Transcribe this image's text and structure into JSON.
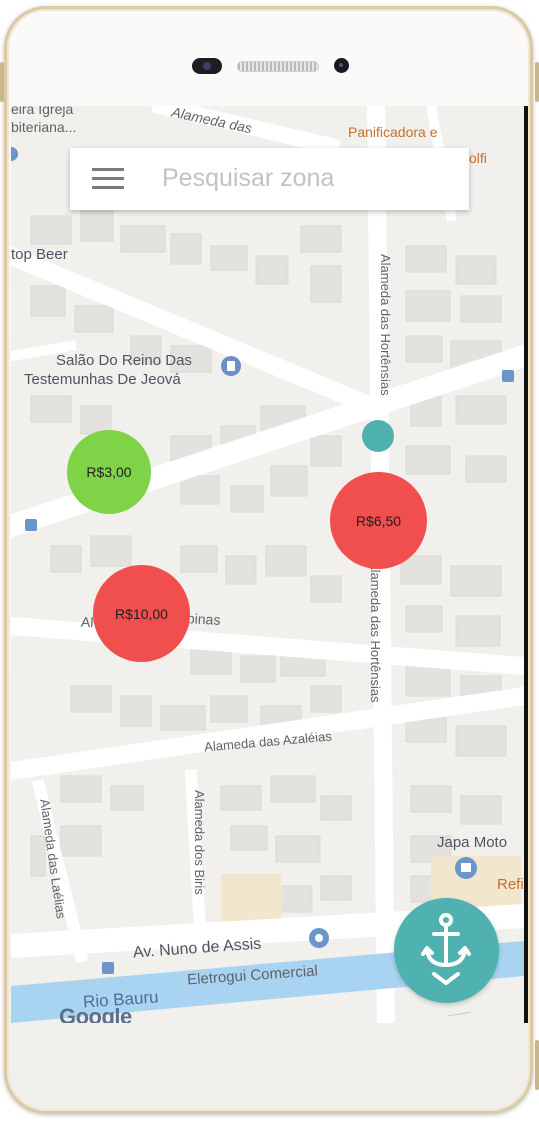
{
  "search": {
    "placeholder": "Pesquisar zona"
  },
  "map": {
    "labels": {
      "igreja_line1": "eira Igreja",
      "igreja_line2": "biteriana...",
      "alameda_top": "Alameda das",
      "panificadora": "Panificadora e",
      "olfi": "olfi",
      "top_beer": "top Beer",
      "hortensias_top": "Alameda das Hortênsias",
      "salao_line1": "Salão Do Reino Das",
      "salao_line2": "Testemunhas De Jeová",
      "alameda_al": "Al",
      "pinas": "pinas",
      "hortensias_bottom": "Alameda das Hortênsias",
      "azaleias": "Alameda das Azaléias",
      "laelias": "Alameda das Laélias",
      "biris": "Alameda dos Biris",
      "japa_moto": "Japa Moto",
      "refi": "Refi",
      "nuno": "Av. Nuno de Assis",
      "eletrogui": "Eletrogui Comercial",
      "rio": "Rio Bauru",
      "google": "Google"
    }
  },
  "zones": [
    {
      "price": "R$3,00",
      "color": "#7ed346"
    },
    {
      "price": "R$6,50",
      "color": "#f14e4e"
    },
    {
      "price": "R$10,00",
      "color": "#f14e4e"
    }
  ],
  "fab": {
    "icon": "anchor-icon"
  },
  "colors": {
    "accent": "#4fb2b0",
    "expensive": "#f14e4e",
    "cheap": "#7ed346"
  }
}
